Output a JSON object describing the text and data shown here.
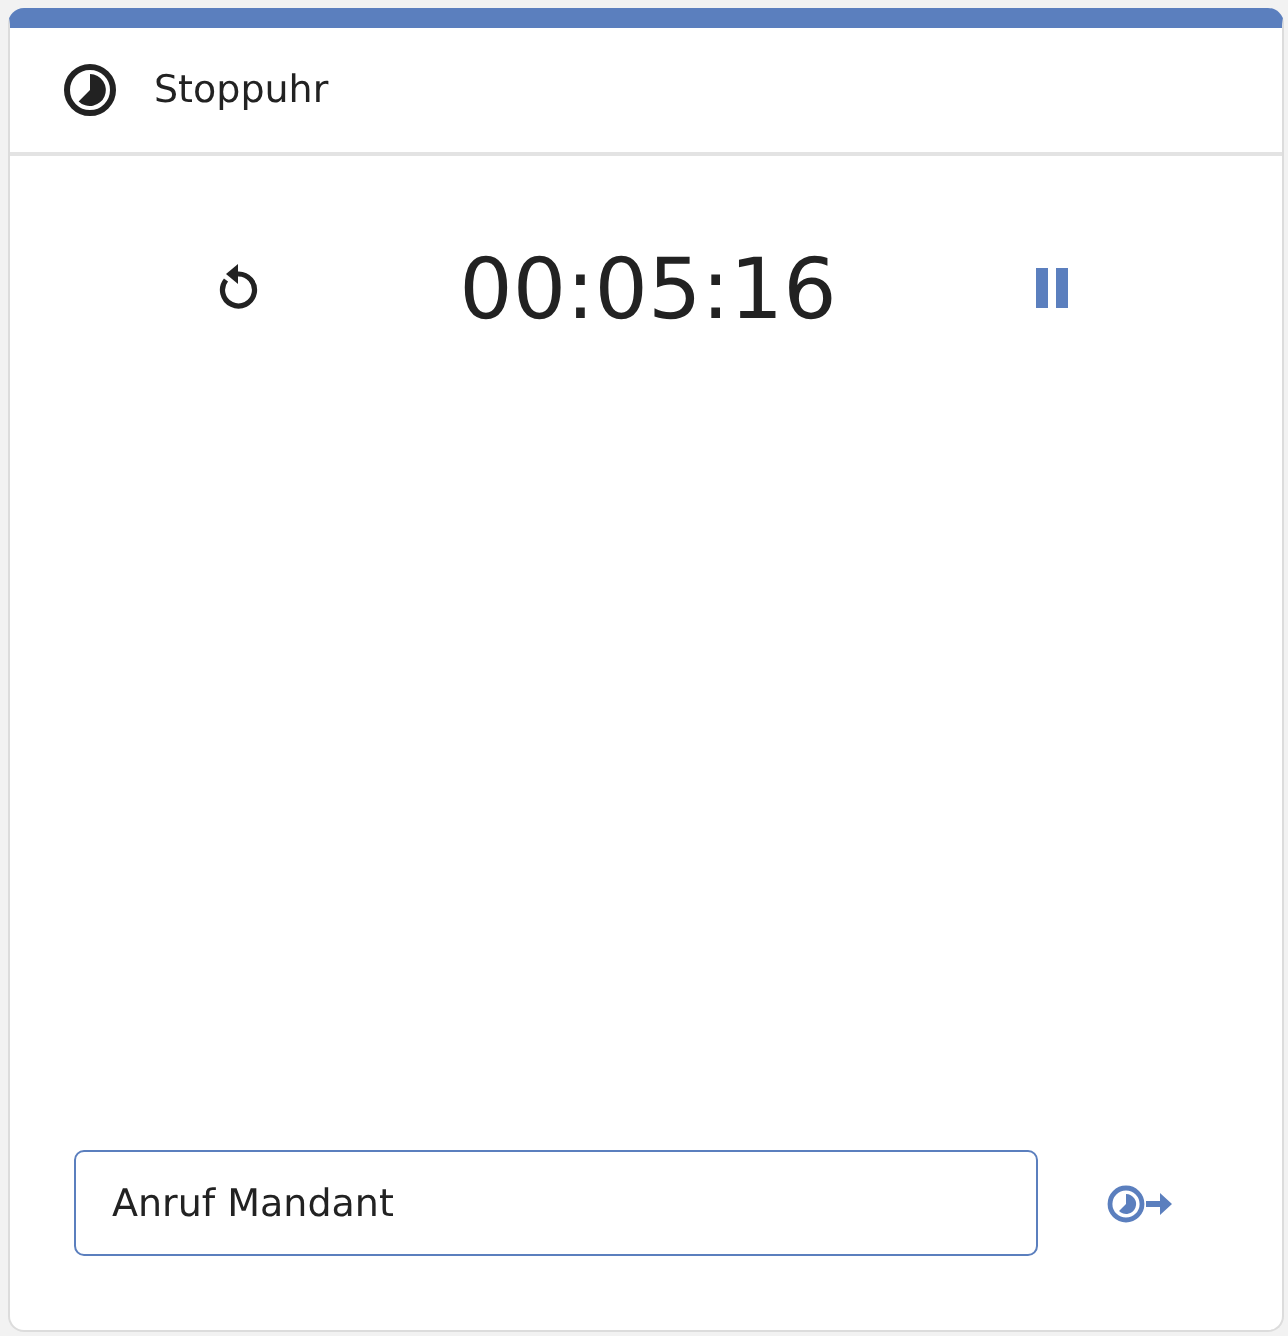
{
  "header": {
    "title": "Stoppuhr"
  },
  "timer": {
    "time": "00:05:16",
    "running": true
  },
  "task_field": {
    "value": "Anruf Mandant",
    "focused": true
  }
}
